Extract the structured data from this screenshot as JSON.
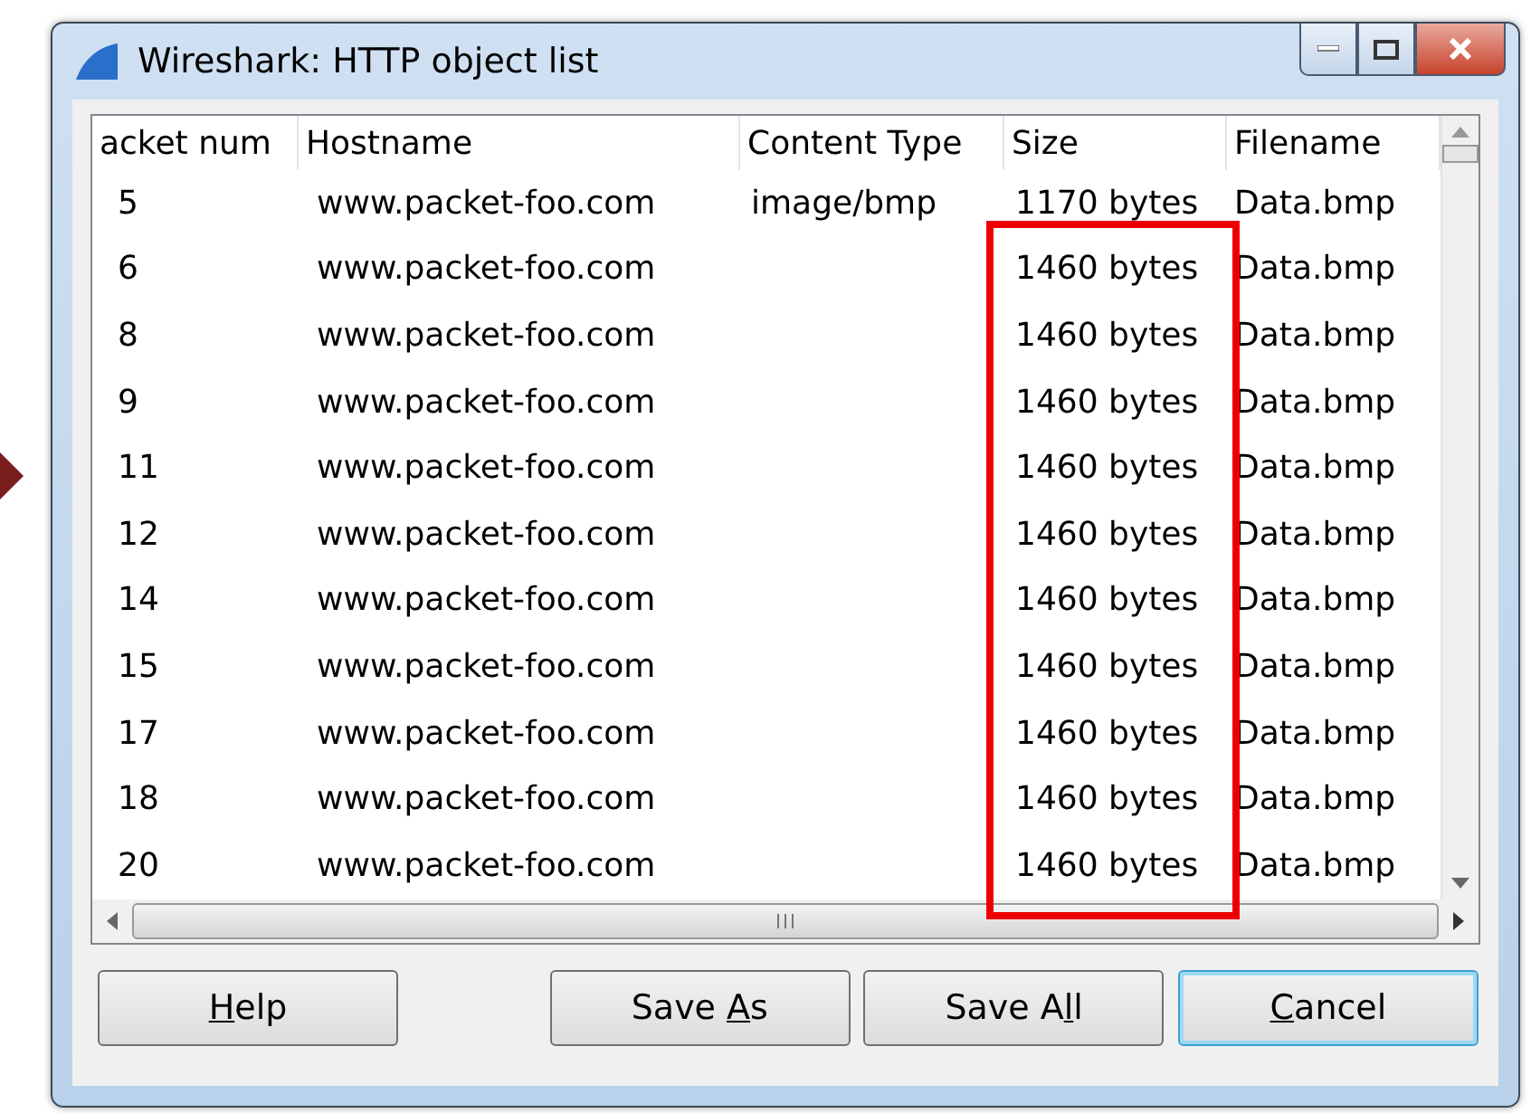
{
  "window": {
    "title": "Wireshark: HTTP object list"
  },
  "table": {
    "columns": [
      "acket num",
      "Hostname",
      "Content Type",
      "Size",
      "Filename"
    ],
    "rows": [
      [
        "5",
        "www.packet-foo.com",
        "image/bmp",
        "1170 bytes",
        "Data.bmp"
      ],
      [
        "6",
        "www.packet-foo.com",
        "",
        "1460 bytes",
        "Data.bmp"
      ],
      [
        "8",
        "www.packet-foo.com",
        "",
        "1460 bytes",
        "Data.bmp"
      ],
      [
        "9",
        "www.packet-foo.com",
        "",
        "1460 bytes",
        "Data.bmp"
      ],
      [
        "11",
        "www.packet-foo.com",
        "",
        "1460 bytes",
        "Data.bmp"
      ],
      [
        "12",
        "www.packet-foo.com",
        "",
        "1460 bytes",
        "Data.bmp"
      ],
      [
        "14",
        "www.packet-foo.com",
        "",
        "1460 bytes",
        "Data.bmp"
      ],
      [
        "15",
        "www.packet-foo.com",
        "",
        "1460 bytes",
        "Data.bmp"
      ],
      [
        "17",
        "www.packet-foo.com",
        "",
        "1460 bytes",
        "Data.bmp"
      ],
      [
        "18",
        "www.packet-foo.com",
        "",
        "1460 bytes",
        "Data.bmp"
      ],
      [
        "20",
        "www.packet-foo.com",
        "",
        "1460 bytes",
        "Data.bmp"
      ]
    ]
  },
  "buttons": [
    {
      "key": "H",
      "after": "elp",
      "default": false
    },
    {
      "before": "Save ",
      "key": "A",
      "after": "s",
      "default": false
    },
    {
      "before": "Save A",
      "key": "l",
      "after": "l",
      "default": false
    },
    {
      "key": "C",
      "after": "ancel",
      "default": true
    }
  ]
}
